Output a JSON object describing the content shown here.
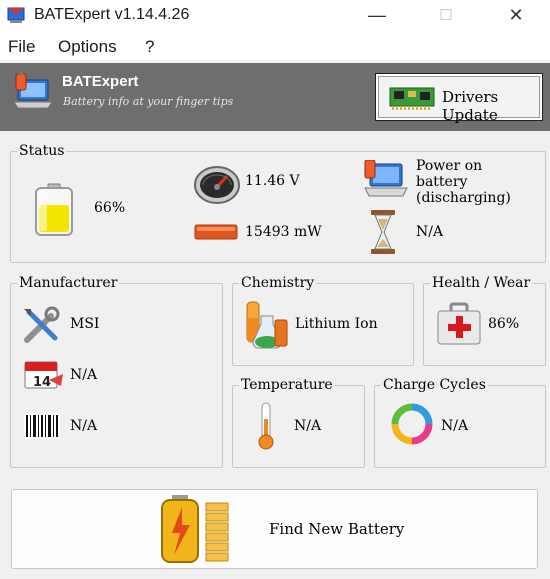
{
  "window": {
    "title": "BATExpert v1.14.4.26",
    "minimize": "—",
    "maximize": "☐",
    "close": "✕"
  },
  "menu": {
    "file": "File",
    "options": "Options",
    "help": "?"
  },
  "header": {
    "app_name": "BATExpert",
    "tagline": "Battery info at your finger tips",
    "drivers_button": "Drivers Update"
  },
  "status": {
    "label": "Status",
    "charge": "66%",
    "charge_fraction": 0.66,
    "voltage": "11.46 V",
    "power_rate": "15493 mW",
    "power_source": "Power on battery (discharging)",
    "time_remaining": "N/A"
  },
  "manufacturer": {
    "label": "Manufacturer",
    "name": "MSI",
    "date": "N/A",
    "serial": "N/A"
  },
  "chemistry": {
    "label": "Chemistry",
    "value": "Lithium Ion"
  },
  "health": {
    "label": "Health / Wear",
    "value": "86%"
  },
  "temperature": {
    "label": "Temperature",
    "value": "N/A"
  },
  "cycles": {
    "label": "Charge Cycles",
    "value": "N/A"
  },
  "find_button": {
    "label": "Find New Battery"
  },
  "colors": {
    "header_bg": "#6e6e6e",
    "battery_fill": "#f2e600",
    "power_bar": "#e0541d",
    "health_red": "#d71920"
  }
}
